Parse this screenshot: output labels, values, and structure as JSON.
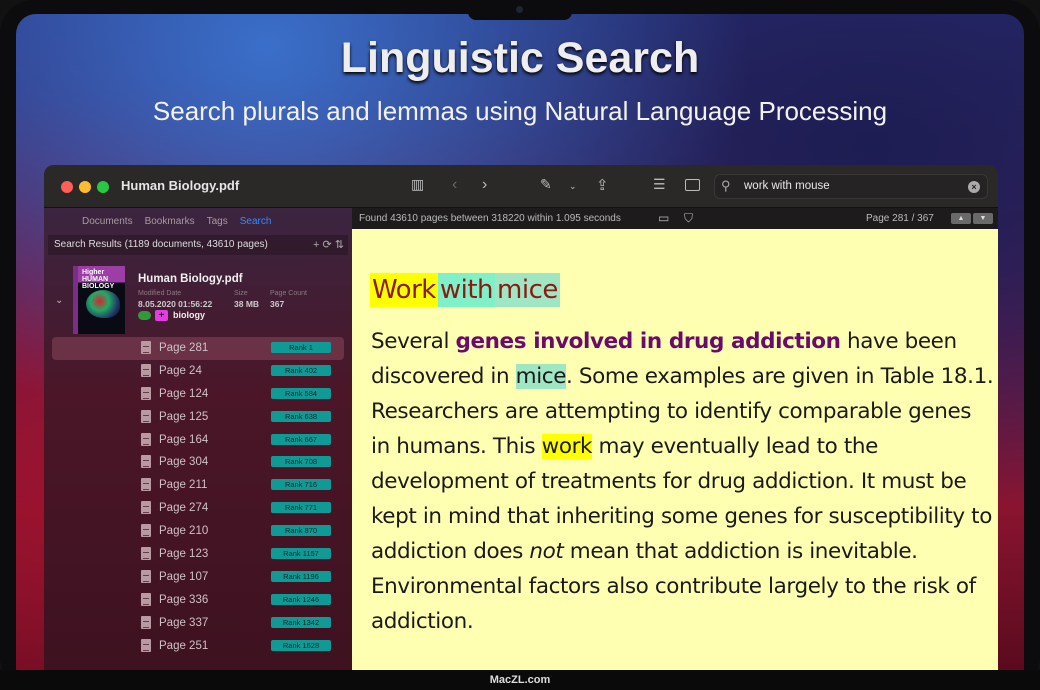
{
  "promo": {
    "headline": "Linguistic Search",
    "subheadline": "Search plurals and lemmas using Natural Language Processing"
  },
  "window": {
    "title": "Human Biology.pdf",
    "search": {
      "value": "work with mouse"
    },
    "icons": [
      "sidebar-icon",
      "back-icon",
      "forward-icon",
      "highlighter-icon",
      "chevron-down-icon",
      "share-icon",
      "list-icon",
      "single-page-icon"
    ]
  },
  "sidebar": {
    "tabs": [
      {
        "label": "Documents"
      },
      {
        "label": "Bookmarks"
      },
      {
        "label": "Tags"
      },
      {
        "label": "Search",
        "active": true
      }
    ],
    "results_header": "Search Results (1189 documents, 43610 pages)",
    "document": {
      "name": "Human Biology.pdf",
      "cover_title": "Higher HUMAN BIOLOGY",
      "modified_label": "Modified Date",
      "modified": "8.05.2020 01:56:22",
      "size_label": "Size",
      "size": "38 MB",
      "count_label": "Page Count",
      "count": "367",
      "tag": "biology"
    },
    "results": [
      {
        "page": "Page 281",
        "rank": "Rank 1"
      },
      {
        "page": "Page 24",
        "rank": "Rank 402"
      },
      {
        "page": "Page 124",
        "rank": "Rank 584"
      },
      {
        "page": "Page 125",
        "rank": "Rank 638"
      },
      {
        "page": "Page 164",
        "rank": "Rank 667"
      },
      {
        "page": "Page 304",
        "rank": "Rank 708"
      },
      {
        "page": "Page 211",
        "rank": "Rank 716"
      },
      {
        "page": "Page 274",
        "rank": "Rank 771"
      },
      {
        "page": "Page 210",
        "rank": "Rank 870"
      },
      {
        "page": "Page 123",
        "rank": "Rank 1157"
      },
      {
        "page": "Page 107",
        "rank": "Rank 1196"
      },
      {
        "page": "Page 336",
        "rank": "Rank 1246"
      },
      {
        "page": "Page 337",
        "rank": "Rank 1342"
      },
      {
        "page": "Page 251",
        "rank": "Rank 1628"
      }
    ]
  },
  "status": {
    "found": "Found 43610 pages between 318220 within 1.095 seconds",
    "page_indicator": "Page 281 / 367"
  },
  "document_page": {
    "heading": [
      {
        "t": "Work",
        "c": "hl-y"
      },
      {
        "t": "with",
        "c": "hl-a"
      },
      {
        "t": "mice",
        "c": "hl-g"
      }
    ],
    "body": [
      {
        "t": "Several "
      },
      {
        "t": "genes involved in drug addiction",
        "c": "bold"
      },
      {
        "t": " have been discovered in "
      },
      {
        "t": "mice",
        "c": "hl-g"
      },
      {
        "t": ". Some examples are given in Table 18.1. Researchers are attempting to identify comparable genes in humans. This "
      },
      {
        "t": "work",
        "c": "hl-y"
      },
      {
        "t": " may eventually lead to the development of treatments for drug addiction. It must be kept in mind that inheriting some genes for susceptibility to addiction does "
      },
      {
        "t": "not",
        "c": "it"
      },
      {
        "t": " mean that addiction is inevitable. Environmental factors also contribute largely to the risk of addiction."
      }
    ]
  },
  "footer": {
    "watermark": "MacZL.com"
  }
}
